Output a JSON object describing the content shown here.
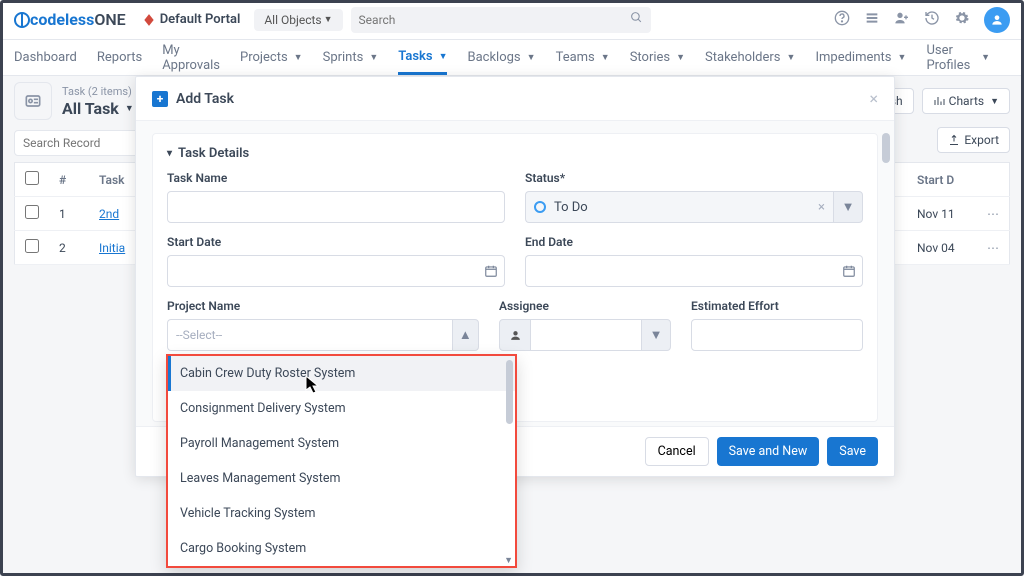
{
  "header": {
    "logo_brand": "codeless",
    "logo_suffix": "ONE",
    "portal": "Default Portal",
    "objects_dd": "All Objects",
    "search_ph": "Search"
  },
  "nav": {
    "items": [
      "Dashboard",
      "Reports",
      "My Approvals",
      "Projects",
      "Sprints",
      "Tasks",
      "Backlogs",
      "Teams",
      "Stories",
      "Stakeholders",
      "Impediments",
      "User Profiles"
    ],
    "active_index": 5
  },
  "page": {
    "subtitle": "Task (2 items)",
    "title": "All Task",
    "refresh_btn": "sh",
    "charts_btn": "Charts",
    "export_btn": "Export",
    "search_ph": "Search Record"
  },
  "table": {
    "headers": {
      "num": "#",
      "name": "Task",
      "date": "Start D"
    },
    "rows": [
      {
        "num": "1",
        "name": "2nd",
        "date": "Nov 11"
      },
      {
        "num": "2",
        "name": "Initia",
        "date": "Nov 04"
      }
    ]
  },
  "modal": {
    "title": "Add Task",
    "section": "Task Details",
    "labels": {
      "task_name": "Task Name",
      "status": "Status*",
      "start": "Start Date",
      "end": "End Date",
      "project": "Project Name",
      "assignee": "Assignee",
      "effort": "Estimated Effort"
    },
    "status_value": "To Do",
    "project_ph": "--Select--",
    "project_options": [
      "Cabin Crew Duty Roster System",
      "Consignment Delivery System",
      "Payroll Management System",
      "Leaves Management System",
      "Vehicle Tracking System",
      "Cargo Booking System"
    ],
    "footer": {
      "cancel": "Cancel",
      "save_new": "Save and New",
      "save": "Save"
    }
  }
}
